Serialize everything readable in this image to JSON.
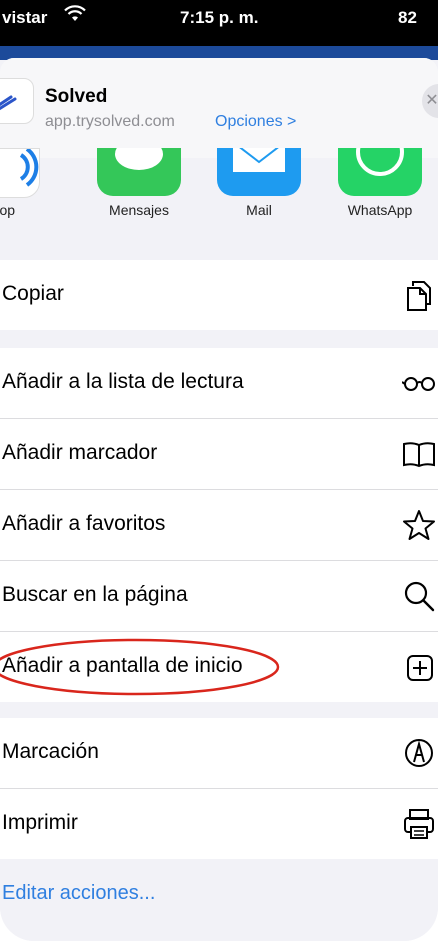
{
  "status": {
    "carrier": "vistar",
    "time": "7:15 p. m.",
    "battery": "82"
  },
  "header": {
    "title": "Solved",
    "url": "app.trysolved.com",
    "options_label": "Opciones >",
    "close_label": "✕"
  },
  "share_targets": [
    {
      "label": "AirDrop",
      "visible_label": "irDrop",
      "icon": "airdrop-icon",
      "color": "#ffffff"
    },
    {
      "label": "Mensajes",
      "icon": "messages-icon",
      "color": "#34c759"
    },
    {
      "label": "Mail",
      "icon": "mail-icon",
      "color": "#1e9bf0"
    },
    {
      "label": "WhatsApp",
      "icon": "whatsapp-icon",
      "color": "#25d366"
    }
  ],
  "actions_group1": [
    {
      "label": "Copiar",
      "icon": "copy-icon"
    }
  ],
  "actions_group2": [
    {
      "label": "Añadir a la lista de lectura",
      "icon": "glasses-icon"
    },
    {
      "label": "Añadir marcador",
      "icon": "book-icon"
    },
    {
      "label": "Añadir a favoritos",
      "icon": "star-icon"
    },
    {
      "label": "Buscar en la página",
      "icon": "search-icon"
    },
    {
      "label": "Añadir a pantalla de inicio",
      "icon": "add-square-icon",
      "highlighted": true
    }
  ],
  "actions_group3": [
    {
      "label": "Marcación",
      "icon": "markup-icon"
    },
    {
      "label": "Imprimir",
      "icon": "printer-icon"
    }
  ],
  "edit_actions_label": "Editar acciones...",
  "accent_color": "#2f7fe0",
  "highlight_color": "#d9261c"
}
